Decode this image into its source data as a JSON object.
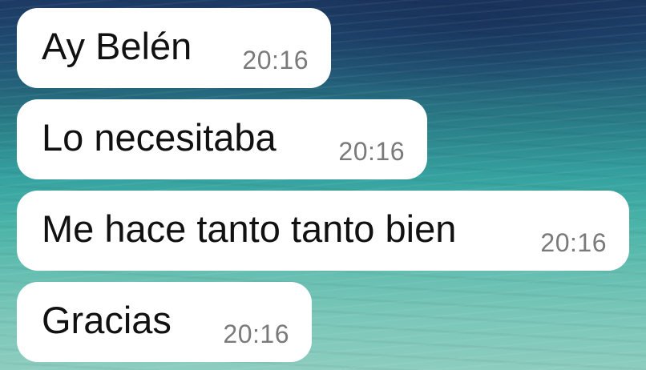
{
  "messages": [
    {
      "text": "Ay Belén",
      "time": "20:16"
    },
    {
      "text": "Lo necesitaba",
      "time": "20:16"
    },
    {
      "text": "Me hace tanto tanto bien",
      "time": "20:16"
    },
    {
      "text": "Gracias",
      "time": "20:16"
    }
  ],
  "colors": {
    "bubble": "#ffffff",
    "text": "#111111",
    "timestamp": "#7a7a7a"
  }
}
